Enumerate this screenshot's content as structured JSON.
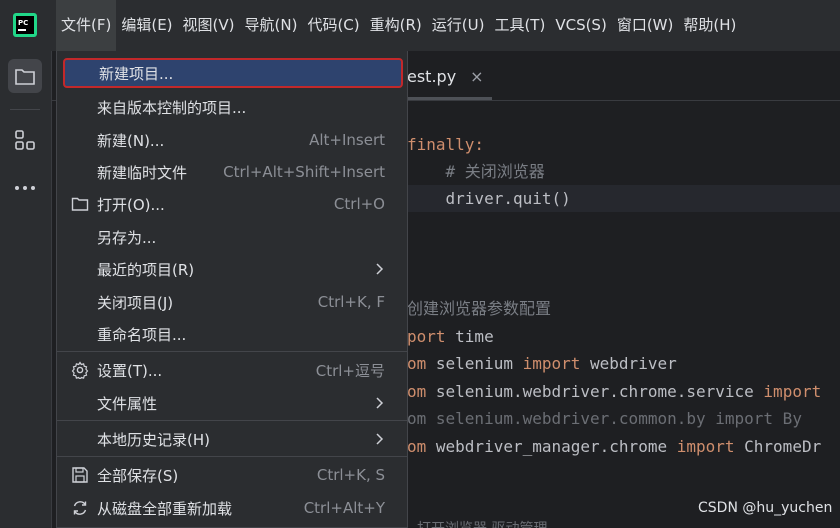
{
  "menubar": {
    "items": [
      {
        "label": "文件(F)"
      },
      {
        "label": "编辑(E)"
      },
      {
        "label": "视图(V)"
      },
      {
        "label": "导航(N)"
      },
      {
        "label": "代码(C)"
      },
      {
        "label": "重构(R)"
      },
      {
        "label": "运行(U)"
      },
      {
        "label": "工具(T)"
      },
      {
        "label": "VCS(S)"
      },
      {
        "label": "窗口(W)"
      },
      {
        "label": "帮助(H)"
      }
    ]
  },
  "tab": {
    "name": "est.py",
    "close": "×"
  },
  "code": {
    "lines": [
      {
        "parts": [
          "finally:"
        ]
      },
      {
        "parts": [
          "    # 关闭浏览器"
        ]
      },
      {
        "parts": [
          "    driver.quit()"
        ]
      },
      {
        "parts": [
          "创建浏览器参数配置"
        ]
      },
      {
        "parts": [
          "port",
          " time"
        ]
      },
      {
        "parts": [
          "om",
          " selenium ",
          "import",
          " webdriver"
        ]
      },
      {
        "parts": [
          "om",
          " selenium.webdriver.chrome.service ",
          "import"
        ]
      },
      {
        "parts": [
          "om selenium.webdriver.common.by import By"
        ]
      },
      {
        "parts": [
          "om",
          " webdriver_manager.chrome ",
          "import",
          " ChromeDr"
        ]
      }
    ],
    "bottom": "打开浏览器      驱动管理"
  },
  "file_menu": {
    "items": [
      {
        "label": "新建项目...",
        "shortcut": ""
      },
      {
        "label": "来自版本控制的项目...",
        "shortcut": ""
      },
      {
        "label": "新建(N)...",
        "shortcut": "Alt+Insert"
      },
      {
        "label": "新建临时文件",
        "shortcut": "Ctrl+Alt+Shift+Insert"
      },
      {
        "label": "打开(O)...",
        "shortcut": "Ctrl+O"
      },
      {
        "label": "另存为...",
        "shortcut": ""
      },
      {
        "label": "最近的项目(R)",
        "shortcut": ""
      },
      {
        "label": "关闭项目(J)",
        "shortcut": "Ctrl+K, F"
      },
      {
        "label": "重命名项目...",
        "shortcut": ""
      },
      {
        "label": "设置(T)...",
        "shortcut": "Ctrl+逗号"
      },
      {
        "label": "文件属性",
        "shortcut": ""
      },
      {
        "label": "本地历史记录(H)",
        "shortcut": ""
      },
      {
        "label": "全部保存(S)",
        "shortcut": "Ctrl+K, S"
      },
      {
        "label": "从磁盘全部重新加载",
        "shortcut": "Ctrl+Alt+Y"
      }
    ]
  },
  "watermark": "CSDN @hu_yuchen",
  "colors": {
    "accent": "#2e436e",
    "highlight_border": "#c2282a",
    "keyword": "#cf8e6d"
  }
}
